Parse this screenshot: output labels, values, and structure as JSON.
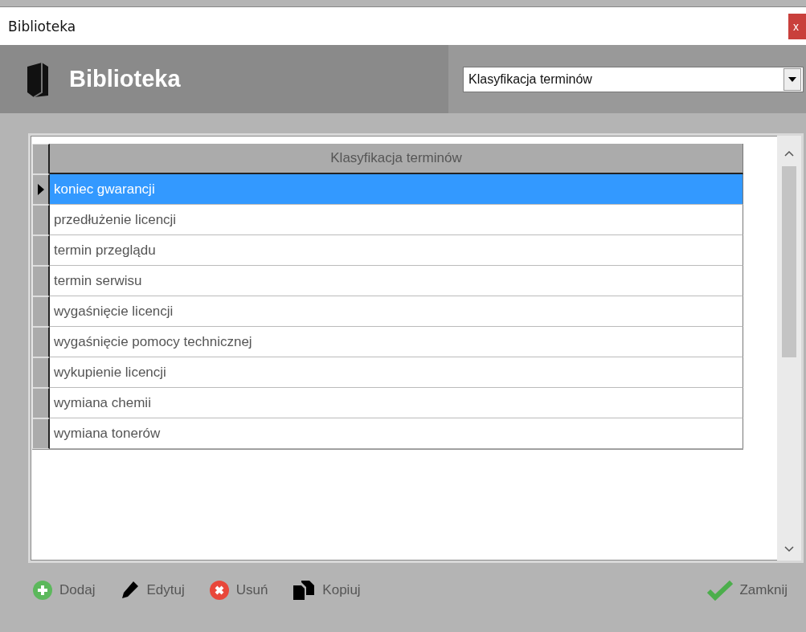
{
  "window": {
    "title": "Biblioteka",
    "close": "x"
  },
  "header": {
    "title": "Biblioteka",
    "dropdown": {
      "value": "Klasyfikacja terminów"
    }
  },
  "table": {
    "columns": [
      "Klasyfikacja terminów"
    ],
    "rows": [
      {
        "cell": "koniec gwarancji",
        "selected": true
      },
      {
        "cell": "przedłużenie licencji",
        "selected": false
      },
      {
        "cell": "termin przeglądu",
        "selected": false
      },
      {
        "cell": "termin serwisu",
        "selected": false
      },
      {
        "cell": "wygaśnięcie licencji",
        "selected": false
      },
      {
        "cell": "wygaśnięcie pomocy technicznej",
        "selected": false
      },
      {
        "cell": "wykupienie licencji",
        "selected": false
      },
      {
        "cell": "wymiana chemii",
        "selected": false
      },
      {
        "cell": "wymiana tonerów",
        "selected": false
      }
    ]
  },
  "buttons": [
    {
      "kind": "add",
      "label": "Dodaj"
    },
    {
      "kind": "edit",
      "label": "Edytuj"
    },
    {
      "kind": "delete",
      "label": "Usuń"
    },
    {
      "kind": "copy",
      "label": "Kopiuj"
    },
    {
      "kind": "close",
      "label": "Zamknij"
    }
  ]
}
